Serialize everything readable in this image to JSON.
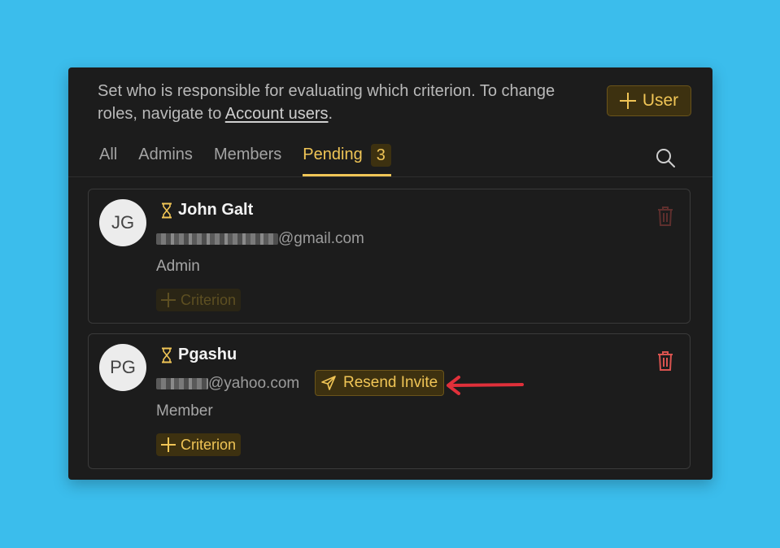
{
  "description": {
    "text": "Set who is responsible for evaluating which criterion. To change roles, navigate to ",
    "link": "Account users",
    "suffix": "."
  },
  "add_user_label": "User",
  "tabs": [
    {
      "label": "All"
    },
    {
      "label": "Admins"
    },
    {
      "label": "Members"
    },
    {
      "label": "Pending",
      "count": "3",
      "active": true
    }
  ],
  "users": [
    {
      "initials": "JG",
      "name": "John Galt",
      "email_domain": "@gmail.com",
      "role": "Admin",
      "criterion_label": "Criterion",
      "criterion_enabled": false
    },
    {
      "initials": "PG",
      "name": "Pgashu",
      "email_domain": "@yahoo.com",
      "role": "Member",
      "criterion_label": "Criterion",
      "criterion_enabled": true,
      "resend_label": "Resend Invite"
    }
  ],
  "colors": {
    "accent": "#f0c556",
    "accent_bg": "#3d3110",
    "panel_bg": "#1c1c1c",
    "page_bg": "#3bbdec",
    "delete_red": "#d9534f",
    "annotation_arrow": "#e0303a"
  },
  "icons": {
    "add": "plus-icon",
    "search": "search-icon",
    "pending": "hourglass-icon",
    "delete": "trash-icon",
    "resend": "send-icon"
  }
}
